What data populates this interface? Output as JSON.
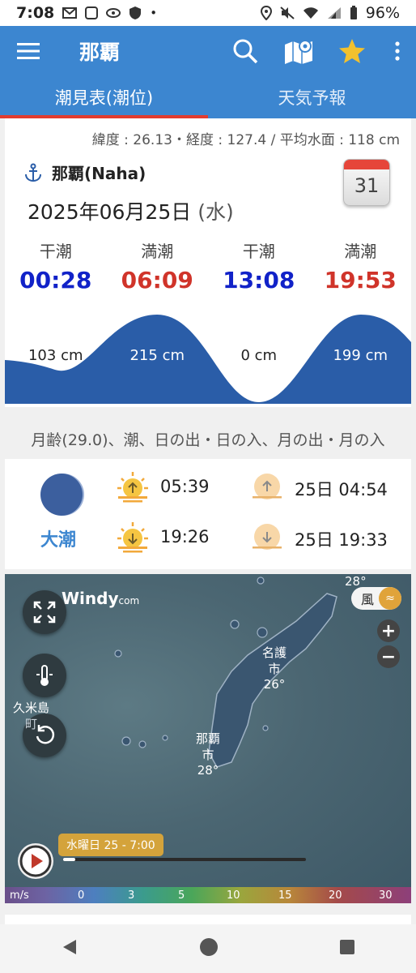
{
  "status_bar": {
    "time": "7:08",
    "battery": "96%"
  },
  "app_bar": {
    "title": "那覇"
  },
  "tabs": [
    {
      "label": "潮見表(潮位)",
      "active": true
    },
    {
      "label": "天気予報",
      "active": false
    }
  ],
  "location": {
    "coords": "緯度 : 26.13・経度 : 127.4 / 平均水面 : 118 cm",
    "name": "那覇(Naha)",
    "date": "2025年06月25日",
    "weekday": "(水)",
    "calendar_day": "31"
  },
  "tides": [
    {
      "label": "干潮",
      "time": "00:28",
      "height": "103 cm",
      "kind": "low"
    },
    {
      "label": "満潮",
      "time": "06:09",
      "height": "215 cm",
      "kind": "high"
    },
    {
      "label": "干潮",
      "time": "13:08",
      "height": "0 cm",
      "kind": "low"
    },
    {
      "label": "満潮",
      "time": "19:53",
      "height": "199 cm",
      "kind": "high"
    }
  ],
  "moon_header": "月齢(29.0)、潮、日の出・日の入、月の出・月の入",
  "moon": {
    "tide_name": "大潮"
  },
  "sun_moon": {
    "sunrise": "05:39",
    "sunset": "19:26",
    "moonrise": "25日 04:54",
    "moonset": "25日 19:33"
  },
  "windy": {
    "logo": "Windy",
    "logo_suffix": "com",
    "layer": "風",
    "timestamp": "水曜日 25 - 7:00",
    "playback_progress": 0.05,
    "labels": [
      {
        "name": "名護",
        "sub": "市",
        "temp": "26°"
      },
      {
        "name": "那覇",
        "sub": "市",
        "temp": "28°"
      },
      {
        "name": "久米島",
        "sub": "町",
        "temp": "28°"
      },
      {
        "name": "町",
        "sub": "",
        "temp": "28°"
      }
    ],
    "scale_unit": "m/s",
    "scale_ticks": [
      "0",
      "3",
      "5",
      "10",
      "15",
      "20",
      "30"
    ]
  },
  "colors": {
    "primary": "#3c86d0",
    "low_tide": "#1122c8",
    "high_tide": "#d0342a",
    "wave": "#2a5da8"
  }
}
